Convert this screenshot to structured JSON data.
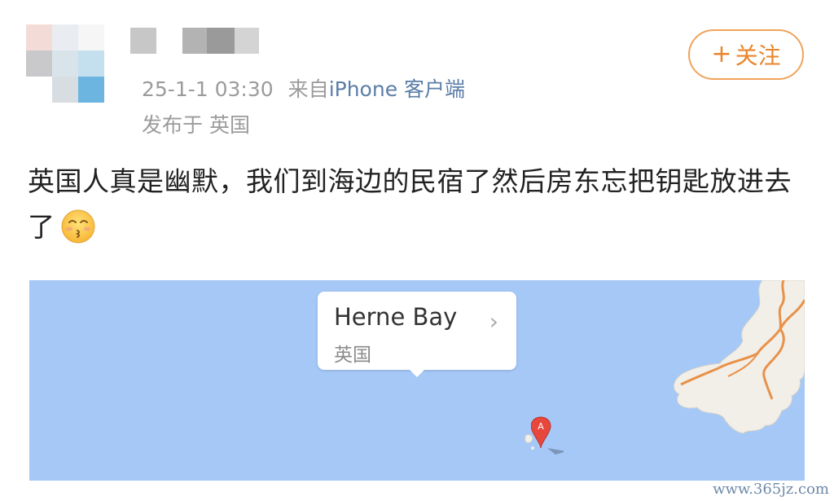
{
  "post": {
    "timestamp": "25-1-1 03:30",
    "source_prefix": "来自",
    "client": "iPhone 客户端",
    "location_line": "发布于 英国",
    "text": "英国人真是幽默，我们到海边的民宿了然后房东忘把钥匙放进去了",
    "emoji_icon": "kissing-face-icon"
  },
  "follow_button": {
    "plus": "+",
    "label": "关注"
  },
  "map": {
    "place_name": "Herne Bay",
    "country": "英国",
    "chevron": "›",
    "marker_letter": "A",
    "water_color": "#a5c8f6",
    "land_color": "#f2efe9",
    "road_color": "#e8914a"
  },
  "watermark": "www.365jz.com",
  "colors": {
    "accent_orange": "#e8862c",
    "link_blue": "#5b7ea8",
    "meta_gray": "#9b9b9b"
  }
}
